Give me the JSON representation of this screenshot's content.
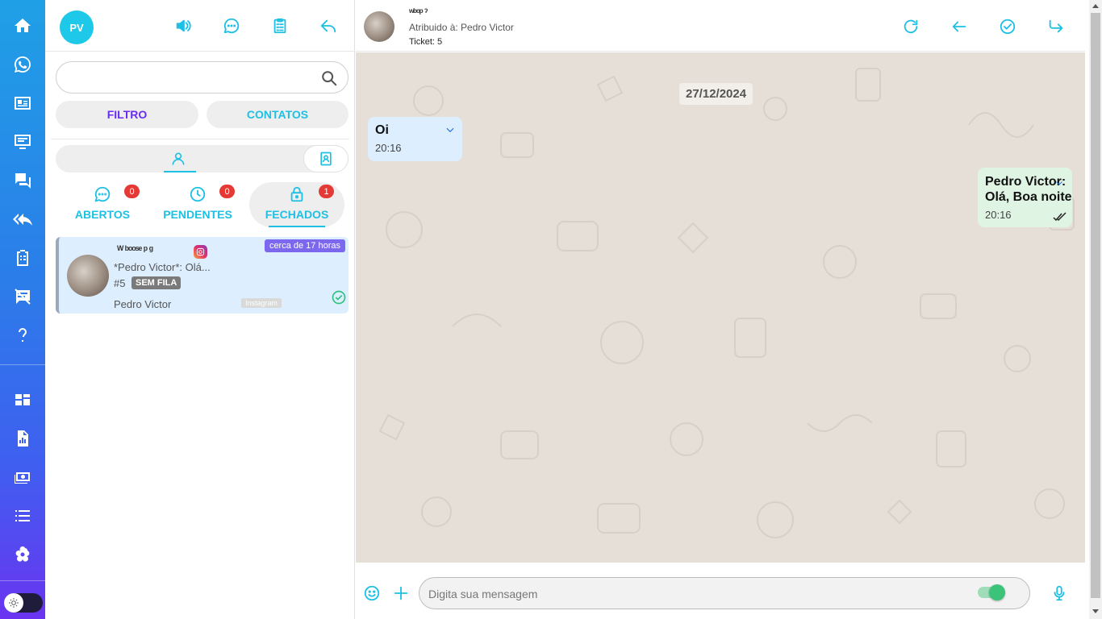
{
  "sidebar": {
    "items": [
      {
        "icon": "home-icon"
      },
      {
        "icon": "whatsapp-icon"
      },
      {
        "icon": "contact-card-icon"
      },
      {
        "icon": "monitor-icon"
      },
      {
        "icon": "chat-icon"
      },
      {
        "icon": "reply-all-icon"
      },
      {
        "icon": "clipboard-icon"
      },
      {
        "icon": "comment-off-icon"
      },
      {
        "icon": "help-icon"
      },
      {
        "icon": "dashboard-icon"
      },
      {
        "icon": "report-icon"
      },
      {
        "icon": "money-icon"
      },
      {
        "icon": "list-icon"
      },
      {
        "icon": "flower-settings-icon"
      }
    ],
    "theme_toggle": "sun-icon"
  },
  "tickets_panel": {
    "user_initials": "PV",
    "search": {
      "placeholder": "",
      "value": ""
    },
    "filter_label": "FILTRO",
    "contacts_label": "CONTATOS",
    "status_tabs": [
      {
        "label": "ABERTOS",
        "count": "0",
        "icon": "chat-bubble-icon"
      },
      {
        "label": "PENDENTES",
        "count": "0",
        "icon": "clock-icon"
      },
      {
        "label": "FECHADOS",
        "count": "1",
        "icon": "lock-icon",
        "active": true
      }
    ],
    "ticket": {
      "name": "ᵂ ᵇᵒᵒˢᵉ ᵖ ᵍ",
      "last_message": "*Pedro Victor*: Olá...",
      "number": "#5",
      "queue": "SEM FILA",
      "time_ago": "cerca de 17 horas",
      "assigned_user": "Pedro Victor",
      "channel": "Instagram"
    }
  },
  "chat": {
    "contact_name": "ʷᵇᵒᵖ ˀ",
    "assigned_to": "Atribuido à: Pedro Victor",
    "ticket_label": "Ticket: 5",
    "date": "27/12/2024",
    "incoming": {
      "text": "Oi",
      "time": "20:16"
    },
    "outgoing": {
      "sender": "Pedro Victor:",
      "text": "Olá, Boa noite",
      "time": "20:16"
    },
    "composer_placeholder": "Digita sua mensagem"
  },
  "colors": {
    "accent": "#1ec0e4",
    "purple": "#6a2cf0",
    "badge": "#e53935",
    "chat_bg": "#e6dfd8"
  }
}
